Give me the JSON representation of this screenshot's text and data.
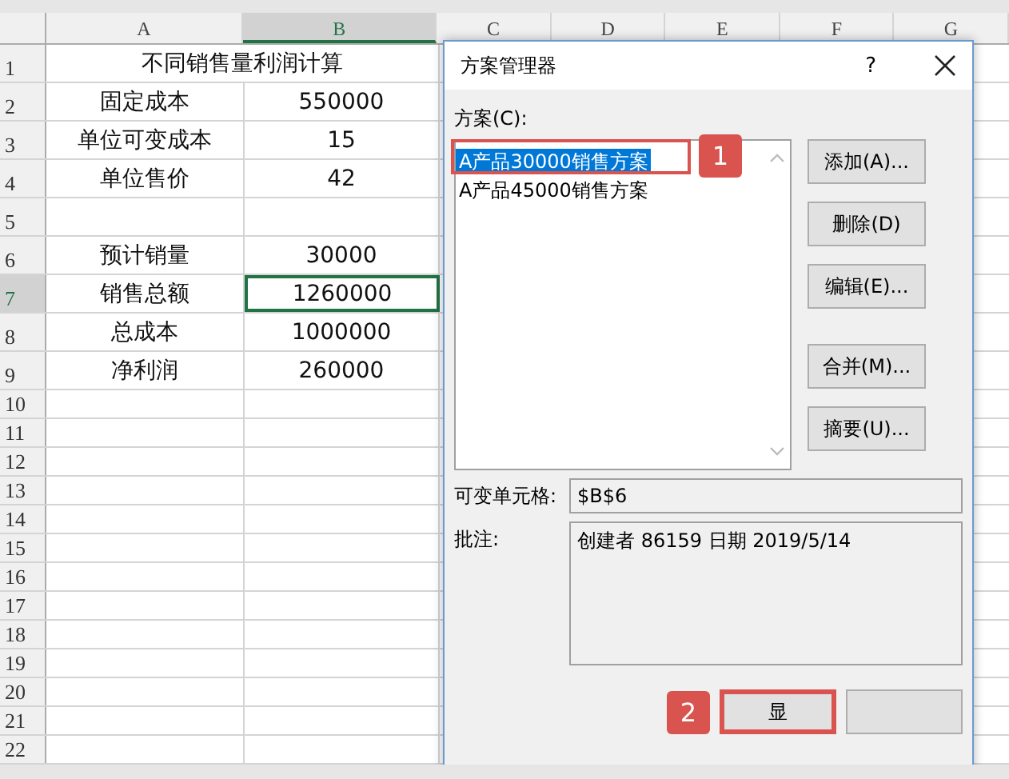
{
  "sheet": {
    "columns": [
      {
        "label": "A",
        "selected": false
      },
      {
        "label": "B",
        "selected": true
      },
      {
        "label": "C",
        "selected": false
      },
      {
        "label": "D",
        "selected": false
      },
      {
        "label": "E",
        "selected": false
      },
      {
        "label": "F",
        "selected": false
      },
      {
        "label": "G",
        "selected": false
      }
    ],
    "rows": [
      {
        "number": "1",
        "kind": "title",
        "selected": false,
        "cells": [
          "不同销售量利润计算"
        ]
      },
      {
        "number": "2",
        "kind": "data",
        "selected": false,
        "cells": [
          "固定成本",
          "550000"
        ]
      },
      {
        "number": "3",
        "kind": "data",
        "selected": false,
        "cells": [
          "单位可变成本",
          "15"
        ]
      },
      {
        "number": "4",
        "kind": "data",
        "selected": false,
        "cells": [
          "单位售价",
          "42"
        ]
      },
      {
        "number": "5",
        "kind": "data",
        "selected": false,
        "cells": []
      },
      {
        "number": "6",
        "kind": "data",
        "selected": false,
        "cells": [
          "预计销量",
          "30000"
        ]
      },
      {
        "number": "7",
        "kind": "data",
        "selected": true,
        "cells": [
          "销售总额",
          "1260000"
        ]
      },
      {
        "number": "8",
        "kind": "data",
        "selected": false,
        "cells": [
          "总成本",
          "1000000"
        ]
      },
      {
        "number": "9",
        "kind": "data",
        "selected": false,
        "cells": [
          "净利润",
          "260000"
        ]
      },
      {
        "number": "10",
        "kind": "empty",
        "selected": false,
        "cells": []
      },
      {
        "number": "11",
        "kind": "empty",
        "selected": false,
        "cells": []
      },
      {
        "number": "12",
        "kind": "empty",
        "selected": false,
        "cells": []
      },
      {
        "number": "13",
        "kind": "empty",
        "selected": false,
        "cells": []
      },
      {
        "number": "14",
        "kind": "empty",
        "selected": false,
        "cells": []
      },
      {
        "number": "15",
        "kind": "empty",
        "selected": false,
        "cells": []
      },
      {
        "number": "16",
        "kind": "empty",
        "selected": false,
        "cells": []
      },
      {
        "number": "17",
        "kind": "empty",
        "selected": false,
        "cells": []
      },
      {
        "number": "18",
        "kind": "empty",
        "selected": false,
        "cells": []
      },
      {
        "number": "19",
        "kind": "empty",
        "selected": false,
        "cells": []
      },
      {
        "number": "20",
        "kind": "empty",
        "selected": false,
        "cells": []
      },
      {
        "number": "21",
        "kind": "empty",
        "selected": false,
        "cells": []
      },
      {
        "number": "22",
        "kind": "empty",
        "selected": false,
        "cells": []
      }
    ]
  },
  "dialog": {
    "title": "方案管理器",
    "help": "?",
    "list_label": "方案(C):",
    "scenarios": [
      {
        "label": "A产品30000销售方案",
        "selected": true,
        "callout": "1"
      },
      {
        "label": "A产品45000销售方案",
        "selected": false
      }
    ],
    "side_buttons": [
      "添加(A)...",
      "删除(D)",
      "编辑(E)...",
      "合并(M)...",
      "摘要(U)..."
    ],
    "changing_cells": {
      "label": "可变单元格:",
      "value": "$B$6"
    },
    "comment": {
      "label": "批注:",
      "value": "创建者 86159 日期 2019/5/14"
    },
    "bottom_buttons": [
      {
        "label": "显",
        "highlighted": true,
        "callout": "2"
      },
      {
        "highlighted": false
      }
    ]
  }
}
